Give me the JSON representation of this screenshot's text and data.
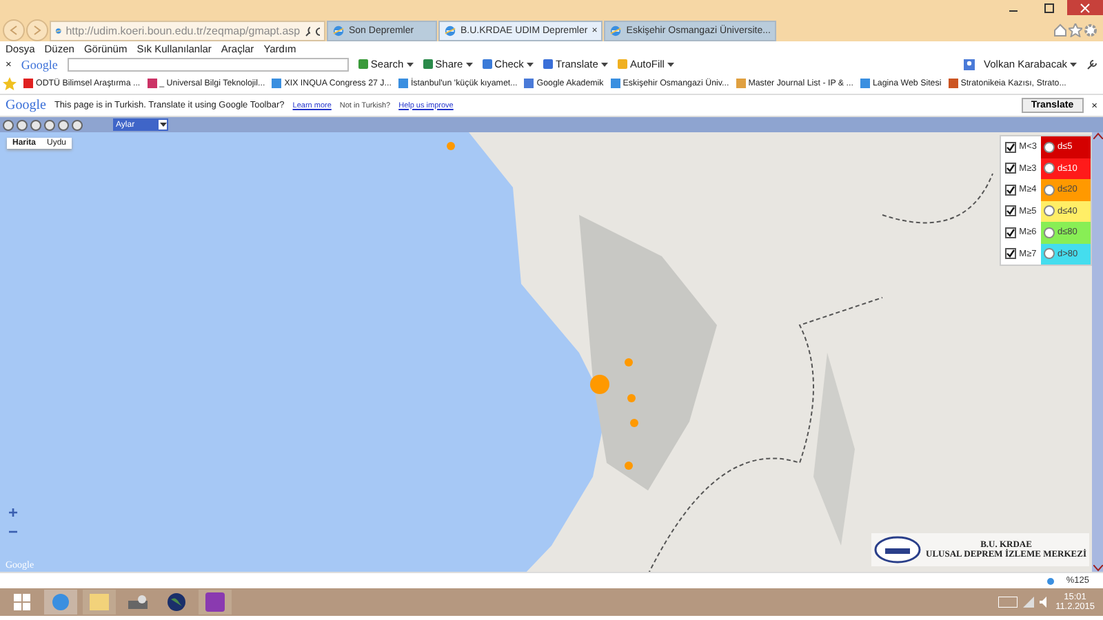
{
  "address_bar": {
    "url": "http://udim.koeri.boun.edu.tr/zeqmap/gmapt.asp"
  },
  "tabs": [
    {
      "label": "Son Depremler",
      "selected": false,
      "closable": false
    },
    {
      "label": "B.U.KRDAE UDIM Depremler",
      "selected": true,
      "closable": true
    },
    {
      "label": "Eskişehir Osmangazi Üniversite...",
      "selected": false,
      "closable": false
    }
  ],
  "close_tab_glyph": "×",
  "menu": [
    "Dosya",
    "Düzen",
    "Görünüm",
    "Sık Kullanılanlar",
    "Araçlar",
    "Yardım"
  ],
  "google_toolbar": {
    "close": "×",
    "logo": "Google",
    "buttons": [
      "Search",
      "Share",
      "Check",
      "Translate",
      "AutoFill"
    ],
    "user": "Volkan Karabacak"
  },
  "favorites": [
    "ODTÜ  Bilimsel Araştırma ...",
    "_ Universal Bilgi Teknolojil...",
    "XIX INQUA Congress  27 J...",
    "İstanbul'un 'küçük kıyamet...",
    "Google Akademik",
    "Eskişehir Osmangazi Üniv...",
    "Master Journal List - IP & ...",
    "Lagina Web Sitesi",
    "Stratonikeia Kazısı, Strato..."
  ],
  "translate_bar": {
    "logo": "Google",
    "message": "This page is in Turkish.  Translate it using Google Toolbar?",
    "learn_more": "Learn more",
    "not_in": "Not in Turkish?",
    "help": "Help us improve",
    "button": "Translate",
    "close": "×"
  },
  "page_toolbar": {
    "period": "Aylar"
  },
  "map": {
    "type_tabs": [
      {
        "label": "Harita",
        "selected": true
      },
      {
        "label": "Uydu",
        "selected": false
      }
    ],
    "zoom_in": "+",
    "zoom_out": "−",
    "attribution": "Google",
    "legend": {
      "magnitudes": [
        {
          "label": "M<3",
          "checked": true
        },
        {
          "label": "M≥3",
          "checked": true
        },
        {
          "label": "M≥4",
          "checked": true
        },
        {
          "label": "M≥5",
          "checked": true
        },
        {
          "label": "M≥6",
          "checked": true
        },
        {
          "label": "M≥7",
          "checked": true
        }
      ],
      "depths": [
        {
          "label": "d≤5",
          "color": "#d40000"
        },
        {
          "label": "d≤10",
          "color": "#ff1a1a"
        },
        {
          "label": "d≤20",
          "color": "#ff9900"
        },
        {
          "label": "d≤40",
          "color": "#ffee66"
        },
        {
          "label": "d≤80",
          "color": "#88ee55"
        },
        {
          "label": "d>80",
          "color": "#44ddee"
        }
      ]
    },
    "logo_title": "B.U. KRDAE",
    "logo_subtitle": "ULUSAL DEPREM İZLEME MERKEZİ"
  },
  "status_bar": {
    "zoom": "%125"
  },
  "taskbar": {
    "time": "15:01",
    "date": "11.2.2015"
  }
}
